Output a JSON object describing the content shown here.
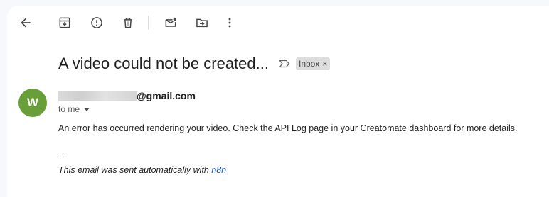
{
  "toolbar": {
    "buttons": [
      {
        "name": "back",
        "icon": "arrow-left-icon"
      },
      {
        "name": "archive",
        "icon": "archive-icon"
      },
      {
        "name": "report-spam",
        "icon": "report-spam-icon"
      },
      {
        "name": "delete",
        "icon": "trash-icon"
      },
      {
        "name": "mark-unread",
        "icon": "mail-dot-icon"
      },
      {
        "name": "move-to",
        "icon": "folder-move-icon"
      },
      {
        "name": "more",
        "icon": "more-vert-icon"
      }
    ]
  },
  "email": {
    "subject": "A video could not be created...",
    "label": "Inbox",
    "label_remove": "×",
    "sender": {
      "avatar_letter": "W",
      "avatar_color": "#689f38",
      "address_suffix": "@gmail.com"
    },
    "to_text": "to me",
    "body": "An error has occurred rendering your video. Check the API Log page in your Creatomate dashboard for more details.",
    "signature_separator": "---",
    "signature_text": "This email was sent automatically with ",
    "signature_link": "n8n"
  },
  "colors": {
    "background": "#f6f8fc",
    "panel": "#ffffff",
    "icon": "#444746",
    "link": "#1155cc",
    "label_chip": "#dddddd"
  }
}
